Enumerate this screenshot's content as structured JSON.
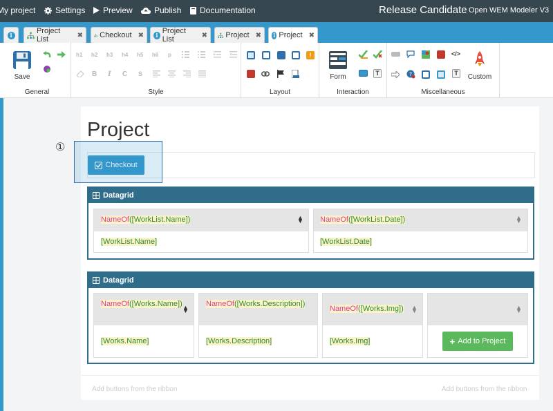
{
  "topbar": {
    "my_project": "My project",
    "settings": "Settings",
    "preview": "Preview",
    "publish": "Publish",
    "documentation": "Documentation",
    "release": "Release Candidate",
    "product": "Open WEM Modeler V3"
  },
  "tabs": [
    {
      "label": "",
      "icon": "info-icon"
    },
    {
      "label": "Project List",
      "icon": "hierarchy-icon"
    },
    {
      "label": "Checkout",
      "icon": "hierarchy-icon"
    },
    {
      "label": "Project List",
      "icon": "info-icon"
    },
    {
      "label": "Project",
      "icon": "hierarchy-icon"
    },
    {
      "label": "Project",
      "icon": "info-icon"
    }
  ],
  "ribbon": {
    "general": {
      "label": "General",
      "save": "Save"
    },
    "style": {
      "label": "Style",
      "headings": [
        "h1",
        "h2",
        "h3",
        "h4",
        "h5",
        "h6",
        "p"
      ],
      "format": [
        "B",
        "I",
        "C",
        "S"
      ]
    },
    "layout": {
      "label": "Layout"
    },
    "interaction": {
      "label": "Interaction",
      "form": "Form",
      "text_t": "T"
    },
    "misc": {
      "label": "Miscellaneous",
      "custom": "Custom",
      "text_t": "T",
      "code": "</>"
    }
  },
  "page": {
    "title": "Project",
    "step_marker": "①",
    "checkout_button": "Checkout"
  },
  "datagrid1": {
    "header": "Datagrid",
    "columns": [
      {
        "fn": "NameOf",
        "arg": "([WorkList.Name])",
        "value": "[WorkList.Name]"
      },
      {
        "fn": "NameOf",
        "arg": "([WorkList.Date])",
        "value": "[WorkList.Date]"
      }
    ]
  },
  "datagrid2": {
    "header": "Datagrid",
    "columns": [
      {
        "fn": "NameOf",
        "arg": "([Works.Name])",
        "value": "[Works.Name]"
      },
      {
        "fn": "NameOf",
        "arg": "([Works.Description])",
        "value": "[Works.Description]"
      },
      {
        "fn": "NameOf",
        "arg": "([Works.Img])",
        "value": "[Works.Img]"
      }
    ],
    "add_button": "Add to Project"
  },
  "hints": {
    "left": "Add buttons from the ribbon",
    "right": "Add buttons from the ribbon"
  },
  "colors": {
    "topbar": "#37474f",
    "tabstrip": "#3498cc",
    "primary": "#3498cc",
    "datagrid": "#306d8b",
    "success": "#5cb85c",
    "fn_text": "#e0399b",
    "field_text": "#2e8b3a",
    "highlight": "#fbf4c8"
  }
}
